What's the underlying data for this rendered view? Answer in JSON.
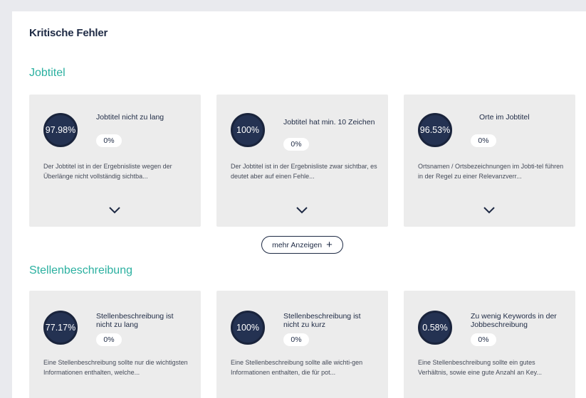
{
  "panel": {
    "title": "Kritische Fehler"
  },
  "sections": {
    "jobtitel": {
      "title": "Jobtitel",
      "cards": [
        {
          "score": "97.98%",
          "name": "Jobtitel nicht zu lang",
          "percent": "0%",
          "description": "Der Jobtitel ist in der Ergebnisliste wegen der Überlänge nicht vollständig sichtba..."
        },
        {
          "score": "100%",
          "name": "Jobtitel hat min. 10 Zeichen",
          "percent": "0%",
          "description": "Der Jobtitel ist in der Ergebnisliste zwar sichtbar, es deutet aber auf einen Fehle..."
        },
        {
          "score": "96.53%",
          "name": "Orte im Jobtitel",
          "percent": "0%",
          "description": "Ortsnamen / Ortsbezeichnungen im Jobti-tel führen in der Regel zu einer Relevanzverr..."
        }
      ],
      "more_label": "mehr Anzeigen",
      "more_icon": "plus-icon"
    },
    "stellenbeschreibung": {
      "title": "Stellenbeschreibung",
      "cards": [
        {
          "score": "77.17%",
          "name": "Stellenbeschreibung ist nicht zu lang",
          "percent": "0%",
          "description": "Eine Stellenbeschreibung sollte nur die wichtigsten Informationen enthalten, welche..."
        },
        {
          "score": "100%",
          "name": "Stellenbeschreibung ist nicht zu kurz",
          "percent": "0%",
          "description": "Eine Stellenbeschreibung sollte alle wichti-gen Informationen enthalten, die für pot..."
        },
        {
          "score": "0.58%",
          "name": "Zu wenig Keywords in der Jobbeschreibung",
          "percent": "0%",
          "description": "Eine Stellenbeschreibung sollte ein gutes Verhältnis, sowie eine gute Anzahl an Key..."
        }
      ]
    }
  },
  "colors": {
    "accent": "#2bb0a0",
    "navy": "#243252",
    "card_bg": "#ececec",
    "page_bg": "#e9eaee"
  },
  "icons": {
    "expand": "chevron-down-icon"
  }
}
